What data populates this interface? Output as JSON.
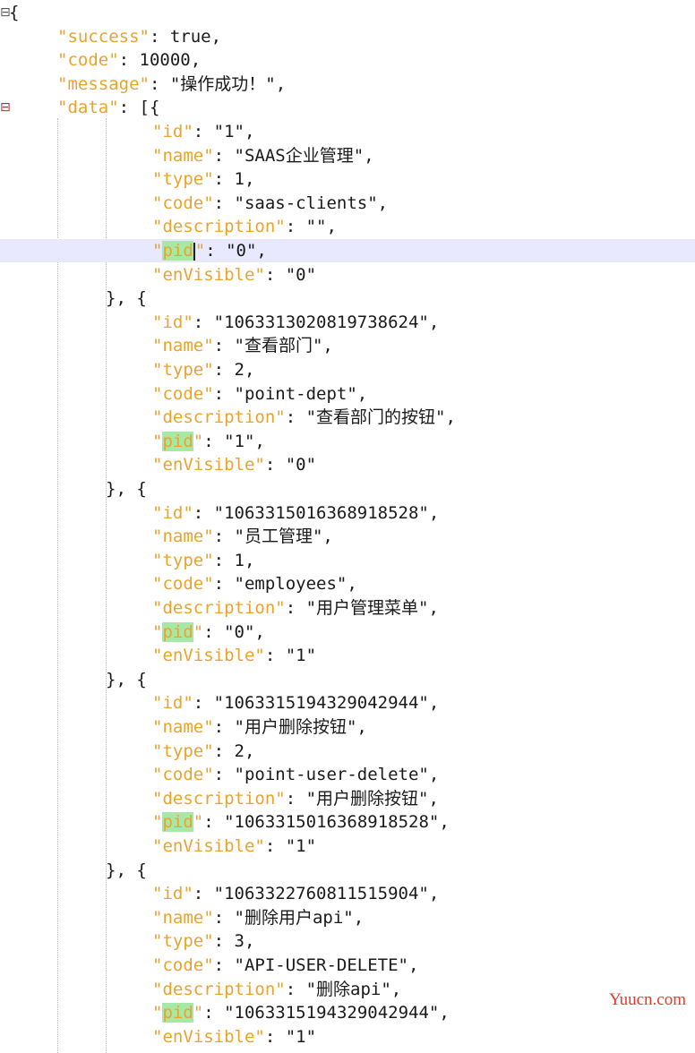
{
  "editor": {
    "lines": [
      {
        "indent": 0,
        "fold": "⊟",
        "parts": [
          [
            "punc",
            "{"
          ]
        ]
      },
      {
        "indent": 1,
        "parts": [
          [
            "key",
            "\"success\""
          ],
          [
            "punc",
            ": true,"
          ]
        ]
      },
      {
        "indent": 1,
        "parts": [
          [
            "key",
            "\"code\""
          ],
          [
            "punc",
            ": 10000,"
          ]
        ]
      },
      {
        "indent": 1,
        "parts": [
          [
            "key",
            "\"message\""
          ],
          [
            "punc",
            ": \"操作成功！\","
          ]
        ]
      },
      {
        "indent": 1,
        "fold": "⊟",
        "parts": [
          [
            "key",
            "\"data\""
          ],
          [
            "punc",
            ": [{"
          ]
        ]
      },
      {
        "indent": 3,
        "parts": [
          [
            "key",
            "\"id\""
          ],
          [
            "punc",
            ": \"1\","
          ]
        ]
      },
      {
        "indent": 3,
        "parts": [
          [
            "key",
            "\"name\""
          ],
          [
            "punc",
            ": \"SAAS企业管理\","
          ]
        ]
      },
      {
        "indent": 3,
        "parts": [
          [
            "key",
            "\"type\""
          ],
          [
            "punc",
            ": 1,"
          ]
        ]
      },
      {
        "indent": 3,
        "parts": [
          [
            "key",
            "\"code\""
          ],
          [
            "punc",
            ": \"saas-clients\","
          ]
        ]
      },
      {
        "indent": 3,
        "parts": [
          [
            "key",
            "\"description\""
          ],
          [
            "punc",
            ": \"\","
          ]
        ]
      },
      {
        "indent": 3,
        "current": true,
        "parts": [
          [
            "key",
            "\""
          ],
          [
            "keyhl",
            "pid"
          ],
          [
            "caret",
            ""
          ],
          [
            "key",
            "\""
          ],
          [
            "punc",
            ": \"0\","
          ]
        ]
      },
      {
        "indent": 3,
        "parts": [
          [
            "key",
            "\"enVisible\""
          ],
          [
            "punc",
            ": \"0\""
          ]
        ]
      },
      {
        "indent": 2,
        "parts": [
          [
            "punc",
            "}, {"
          ]
        ]
      },
      {
        "indent": 3,
        "parts": [
          [
            "key",
            "\"id\""
          ],
          [
            "punc",
            ": \"1063313020819738624\","
          ]
        ]
      },
      {
        "indent": 3,
        "parts": [
          [
            "key",
            "\"name\""
          ],
          [
            "punc",
            ": \"查看部门\","
          ]
        ]
      },
      {
        "indent": 3,
        "parts": [
          [
            "key",
            "\"type\""
          ],
          [
            "punc",
            ": 2,"
          ]
        ]
      },
      {
        "indent": 3,
        "parts": [
          [
            "key",
            "\"code\""
          ],
          [
            "punc",
            ": \"point-dept\","
          ]
        ]
      },
      {
        "indent": 3,
        "parts": [
          [
            "key",
            "\"description\""
          ],
          [
            "punc",
            ": \"查看部门的按钮\","
          ]
        ]
      },
      {
        "indent": 3,
        "parts": [
          [
            "key",
            "\""
          ],
          [
            "keyhl",
            "pid"
          ],
          [
            "key",
            "\""
          ],
          [
            "punc",
            ": \"1\","
          ]
        ]
      },
      {
        "indent": 3,
        "parts": [
          [
            "key",
            "\"enVisible\""
          ],
          [
            "punc",
            ": \"0\""
          ]
        ]
      },
      {
        "indent": 2,
        "parts": [
          [
            "punc",
            "}, {"
          ]
        ]
      },
      {
        "indent": 3,
        "parts": [
          [
            "key",
            "\"id\""
          ],
          [
            "punc",
            ": \"1063315016368918528\","
          ]
        ]
      },
      {
        "indent": 3,
        "parts": [
          [
            "key",
            "\"name\""
          ],
          [
            "punc",
            ": \"员工管理\","
          ]
        ]
      },
      {
        "indent": 3,
        "parts": [
          [
            "key",
            "\"type\""
          ],
          [
            "punc",
            ": 1,"
          ]
        ]
      },
      {
        "indent": 3,
        "parts": [
          [
            "key",
            "\"code\""
          ],
          [
            "punc",
            ": \"employees\","
          ]
        ]
      },
      {
        "indent": 3,
        "parts": [
          [
            "key",
            "\"description\""
          ],
          [
            "punc",
            ": \"用户管理菜单\","
          ]
        ]
      },
      {
        "indent": 3,
        "parts": [
          [
            "key",
            "\""
          ],
          [
            "keyhl",
            "pid"
          ],
          [
            "key",
            "\""
          ],
          [
            "punc",
            ": \"0\","
          ]
        ]
      },
      {
        "indent": 3,
        "parts": [
          [
            "key",
            "\"enVisible\""
          ],
          [
            "punc",
            ": \"1\""
          ]
        ]
      },
      {
        "indent": 2,
        "parts": [
          [
            "punc",
            "}, {"
          ]
        ]
      },
      {
        "indent": 3,
        "parts": [
          [
            "key",
            "\"id\""
          ],
          [
            "punc",
            ": \"1063315194329042944\","
          ]
        ]
      },
      {
        "indent": 3,
        "parts": [
          [
            "key",
            "\"name\""
          ],
          [
            "punc",
            ": \"用户删除按钮\","
          ]
        ]
      },
      {
        "indent": 3,
        "parts": [
          [
            "key",
            "\"type\""
          ],
          [
            "punc",
            ": 2,"
          ]
        ]
      },
      {
        "indent": 3,
        "parts": [
          [
            "key",
            "\"code\""
          ],
          [
            "punc",
            ": \"point-user-delete\","
          ]
        ]
      },
      {
        "indent": 3,
        "parts": [
          [
            "key",
            "\"description\""
          ],
          [
            "punc",
            ": \"用户删除按钮\","
          ]
        ]
      },
      {
        "indent": 3,
        "parts": [
          [
            "key",
            "\""
          ],
          [
            "keyhl",
            "pid"
          ],
          [
            "key",
            "\""
          ],
          [
            "punc",
            ": \"1063315016368918528\","
          ]
        ]
      },
      {
        "indent": 3,
        "parts": [
          [
            "key",
            "\"enVisible\""
          ],
          [
            "punc",
            ": \"1\""
          ]
        ]
      },
      {
        "indent": 2,
        "parts": [
          [
            "punc",
            "}, {"
          ]
        ]
      },
      {
        "indent": 3,
        "parts": [
          [
            "key",
            "\"id\""
          ],
          [
            "punc",
            ": \"1063322760811515904\","
          ]
        ]
      },
      {
        "indent": 3,
        "parts": [
          [
            "key",
            "\"name\""
          ],
          [
            "punc",
            ": \"删除用户api\","
          ]
        ]
      },
      {
        "indent": 3,
        "parts": [
          [
            "key",
            "\"type\""
          ],
          [
            "punc",
            ": 3,"
          ]
        ]
      },
      {
        "indent": 3,
        "parts": [
          [
            "key",
            "\"code\""
          ],
          [
            "punc",
            ": \"API-USER-DELETE\","
          ]
        ]
      },
      {
        "indent": 3,
        "parts": [
          [
            "key",
            "\"description\""
          ],
          [
            "punc",
            ": \"删除api\","
          ]
        ]
      },
      {
        "indent": 3,
        "parts": [
          [
            "key",
            "\""
          ],
          [
            "keyhl",
            "pid"
          ],
          [
            "key",
            "\""
          ],
          [
            "punc",
            ": \"1063315194329042944\","
          ]
        ]
      },
      {
        "indent": 3,
        "parts": [
          [
            "key",
            "\"enVisible\""
          ],
          [
            "punc",
            ": \"1\""
          ]
        ]
      }
    ]
  },
  "watermark": "Yuucn.com",
  "colors": {
    "key": "#e8a42c",
    "highlight": "#a6e8a6",
    "current_line": "#e8e8ff",
    "fold_marker": "#d42020",
    "watermark": "#e23b2e"
  }
}
